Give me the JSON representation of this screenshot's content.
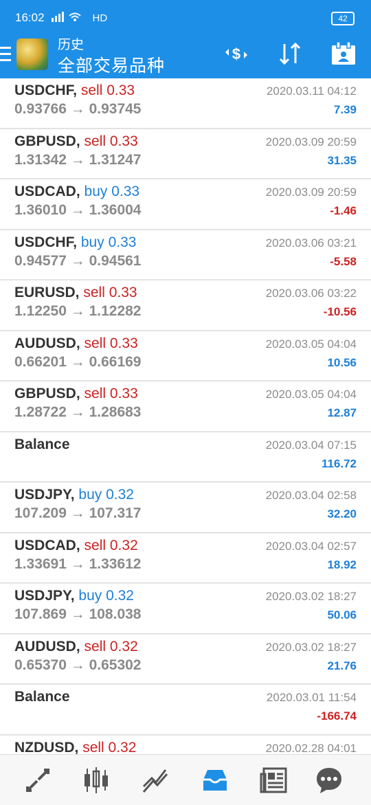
{
  "status": {
    "time": "16:02",
    "signal": "⁴⁶ıll",
    "hd": "HD",
    "battery": "42"
  },
  "header": {
    "title_small": "历史",
    "title_large": "全部交易品种"
  },
  "toolbar": {
    "icons": [
      "currency-exchange-icon",
      "sort-icon",
      "calendar-icon"
    ]
  },
  "trades": [
    {
      "symbol": "USDCHF,",
      "direction": "sell",
      "volume": "0.33",
      "prices": "0.93766 → 0.93745",
      "date": "2020.03.11 04:12",
      "profit": "7.39",
      "profit_sign": "pos"
    },
    {
      "symbol": "GBPUSD,",
      "direction": "sell",
      "volume": "0.33",
      "prices": "1.31342 → 1.31247",
      "date": "2020.03.09 20:59",
      "profit": "31.35",
      "profit_sign": "pos"
    },
    {
      "symbol": "USDCAD,",
      "direction": "buy",
      "volume": "0.33",
      "prices": "1.36010 → 1.36004",
      "date": "2020.03.09 20:59",
      "profit": "-1.46",
      "profit_sign": "neg"
    },
    {
      "symbol": "USDCHF,",
      "direction": "buy",
      "volume": "0.33",
      "prices": "0.94577 → 0.94561",
      "date": "2020.03.06 03:21",
      "profit": "-5.58",
      "profit_sign": "neg"
    },
    {
      "symbol": "EURUSD,",
      "direction": "sell",
      "volume": "0.33",
      "prices": "1.12250 → 1.12282",
      "date": "2020.03.06 03:22",
      "profit": "-10.56",
      "profit_sign": "neg"
    },
    {
      "symbol": "AUDUSD,",
      "direction": "sell",
      "volume": "0.33",
      "prices": "0.66201 → 0.66169",
      "date": "2020.03.05 04:04",
      "profit": "10.56",
      "profit_sign": "pos"
    },
    {
      "symbol": "GBPUSD,",
      "direction": "sell",
      "volume": "0.33",
      "prices": "1.28722 → 1.28683",
      "date": "2020.03.05 04:04",
      "profit": "12.87",
      "profit_sign": "pos"
    },
    {
      "symbol": "Balance",
      "direction": "",
      "volume": "",
      "prices": "",
      "date": "2020.03.04 07:15",
      "profit": "116.72",
      "profit_sign": "pos"
    },
    {
      "symbol": "USDJPY,",
      "direction": "buy",
      "volume": "0.32",
      "prices": "107.209 → 107.317",
      "date": "2020.03.04 02:58",
      "profit": "32.20",
      "profit_sign": "pos"
    },
    {
      "symbol": "USDCAD,",
      "direction": "sell",
      "volume": "0.32",
      "prices": "1.33691 → 1.33612",
      "date": "2020.03.04 02:57",
      "profit": "18.92",
      "profit_sign": "pos"
    },
    {
      "symbol": "USDJPY,",
      "direction": "buy",
      "volume": "0.32",
      "prices": "107.869 → 108.038",
      "date": "2020.03.02 18:27",
      "profit": "50.06",
      "profit_sign": "pos"
    },
    {
      "symbol": "AUDUSD,",
      "direction": "sell",
      "volume": "0.32",
      "prices": "0.65370 → 0.65302",
      "date": "2020.03.02 18:27",
      "profit": "21.76",
      "profit_sign": "pos"
    },
    {
      "symbol": "Balance",
      "direction": "",
      "volume": "",
      "prices": "",
      "date": "2020.03.01 11:54",
      "profit": "-166.74",
      "profit_sign": "neg"
    },
    {
      "symbol": "NZDUSD,",
      "direction": "sell",
      "volume": "0.32",
      "prices": "",
      "date": "2020.02.28 04:01",
      "profit": "",
      "profit_sign": "pos"
    }
  ],
  "bottom_nav": [
    "quotes-icon",
    "chart-icon",
    "trade-icon",
    "history-icon",
    "news-icon",
    "chat-icon"
  ],
  "colors": {
    "header": "#1e8fe6",
    "sell": "#cc2222",
    "buy": "#1e7fd6",
    "active_nav": "#1e8fe6"
  }
}
